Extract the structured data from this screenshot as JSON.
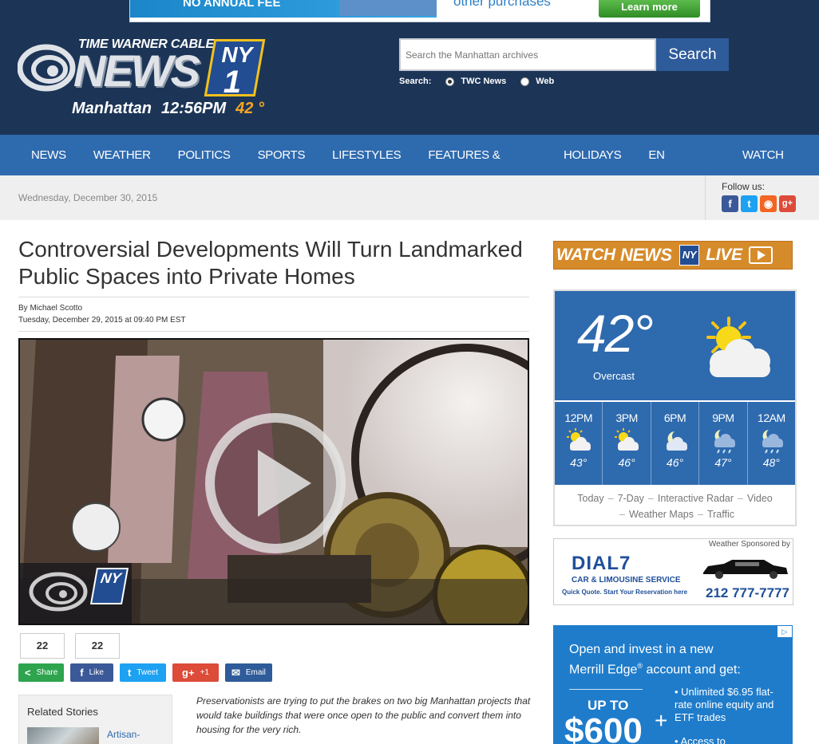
{
  "top_ad": {
    "left_text": "NO ANNUAL FEE",
    "middle_text": "other purchases",
    "button_label": "Learn more"
  },
  "header": {
    "brand_top": "TIME WARNER CABLE",
    "brand_main": "NEWS",
    "brand_badge_ny": "NY",
    "brand_badge_1": "1",
    "location": "Manhattan",
    "time": "12:56PM",
    "temperature": "42 °"
  },
  "search": {
    "placeholder": "Search the Manhattan archives",
    "button_label": "Search",
    "scope_label": "Search:",
    "options": [
      "TWC News",
      "Web"
    ],
    "selected": "TWC News"
  },
  "nav": {
    "items": [
      "NEWS",
      "WEATHER",
      "POLITICS",
      "SPORTS",
      "LIFESTYLES",
      "FEATURES & SHOWS",
      "HOLIDAYS",
      "EN ESPAÑOL",
      "WATCH LIVE"
    ]
  },
  "date_bar": {
    "date": "Wednesday, December 30, 2015",
    "follow_label": "Follow us:",
    "social_icons": [
      "facebook-icon",
      "twitter-icon",
      "rss-icon",
      "google-plus-icon"
    ]
  },
  "article": {
    "headline": "Controversial Developments Will Turn Landmarked Public Spaces into Private Homes",
    "author": "By Michael Scotto",
    "timestamp": "Tuesday, December 29, 2015 at 09:40 PM EST",
    "share_count_1": "22",
    "share_count_2": "22",
    "share_buttons": {
      "share": "Share",
      "like": "Like",
      "tweet": "Tweet",
      "plus": "+1",
      "email": "Email"
    },
    "summary": "Preservationists are trying to put the brakes on two big Manhattan projects that would take buildings that were once open to the public and convert them into housing for the very rich."
  },
  "related": {
    "title": "Related Stories",
    "first_link": "Artisan-"
  },
  "sidebar": {
    "watch_live": {
      "watch": "WATCH",
      "brand": "NEWS",
      "ny": "NY",
      "live": "LIVE"
    },
    "weather": {
      "current_temp": "42°",
      "condition": "Overcast",
      "hourly": [
        {
          "hour": "12PM",
          "temp": "43°",
          "icon": "partly-sunny-icon"
        },
        {
          "hour": "3PM",
          "temp": "46°",
          "icon": "partly-sunny-icon"
        },
        {
          "hour": "6PM",
          "temp": "46°",
          "icon": "cloudy-night-icon"
        },
        {
          "hour": "9PM",
          "temp": "47°",
          "icon": "rain-cloud-night-icon"
        },
        {
          "hour": "12AM",
          "temp": "48°",
          "icon": "rain-cloud-night-icon"
        }
      ],
      "links": [
        "Today",
        "7-Day",
        "Interactive Radar",
        "Video",
        "Weather Maps",
        "Traffic"
      ]
    },
    "sponsor": {
      "label": "Weather Sponsored by",
      "brand": "DIAL7",
      "service": "CAR & LIMOUSINE SERVICE",
      "tagline": "Quick Quote. Start Your Reservation here",
      "phone": "212 777-7777"
    },
    "merrill_ad": {
      "line1": "Open and invest in a new",
      "line2": "Merrill Edge",
      "line2_suffix": " account and get:",
      "up_to": "UP TO",
      "amount": "$600",
      "plus": "+",
      "bullet1": "• Unlimited $6.95 flat-rate online equity and ETF trades",
      "bullet2": "• Access to"
    }
  },
  "colors": {
    "header_bg": "#1c3557",
    "nav_bg": "#2e6aae",
    "weather_bg": "#2e6aae",
    "accent_orange": "#f5a623"
  }
}
